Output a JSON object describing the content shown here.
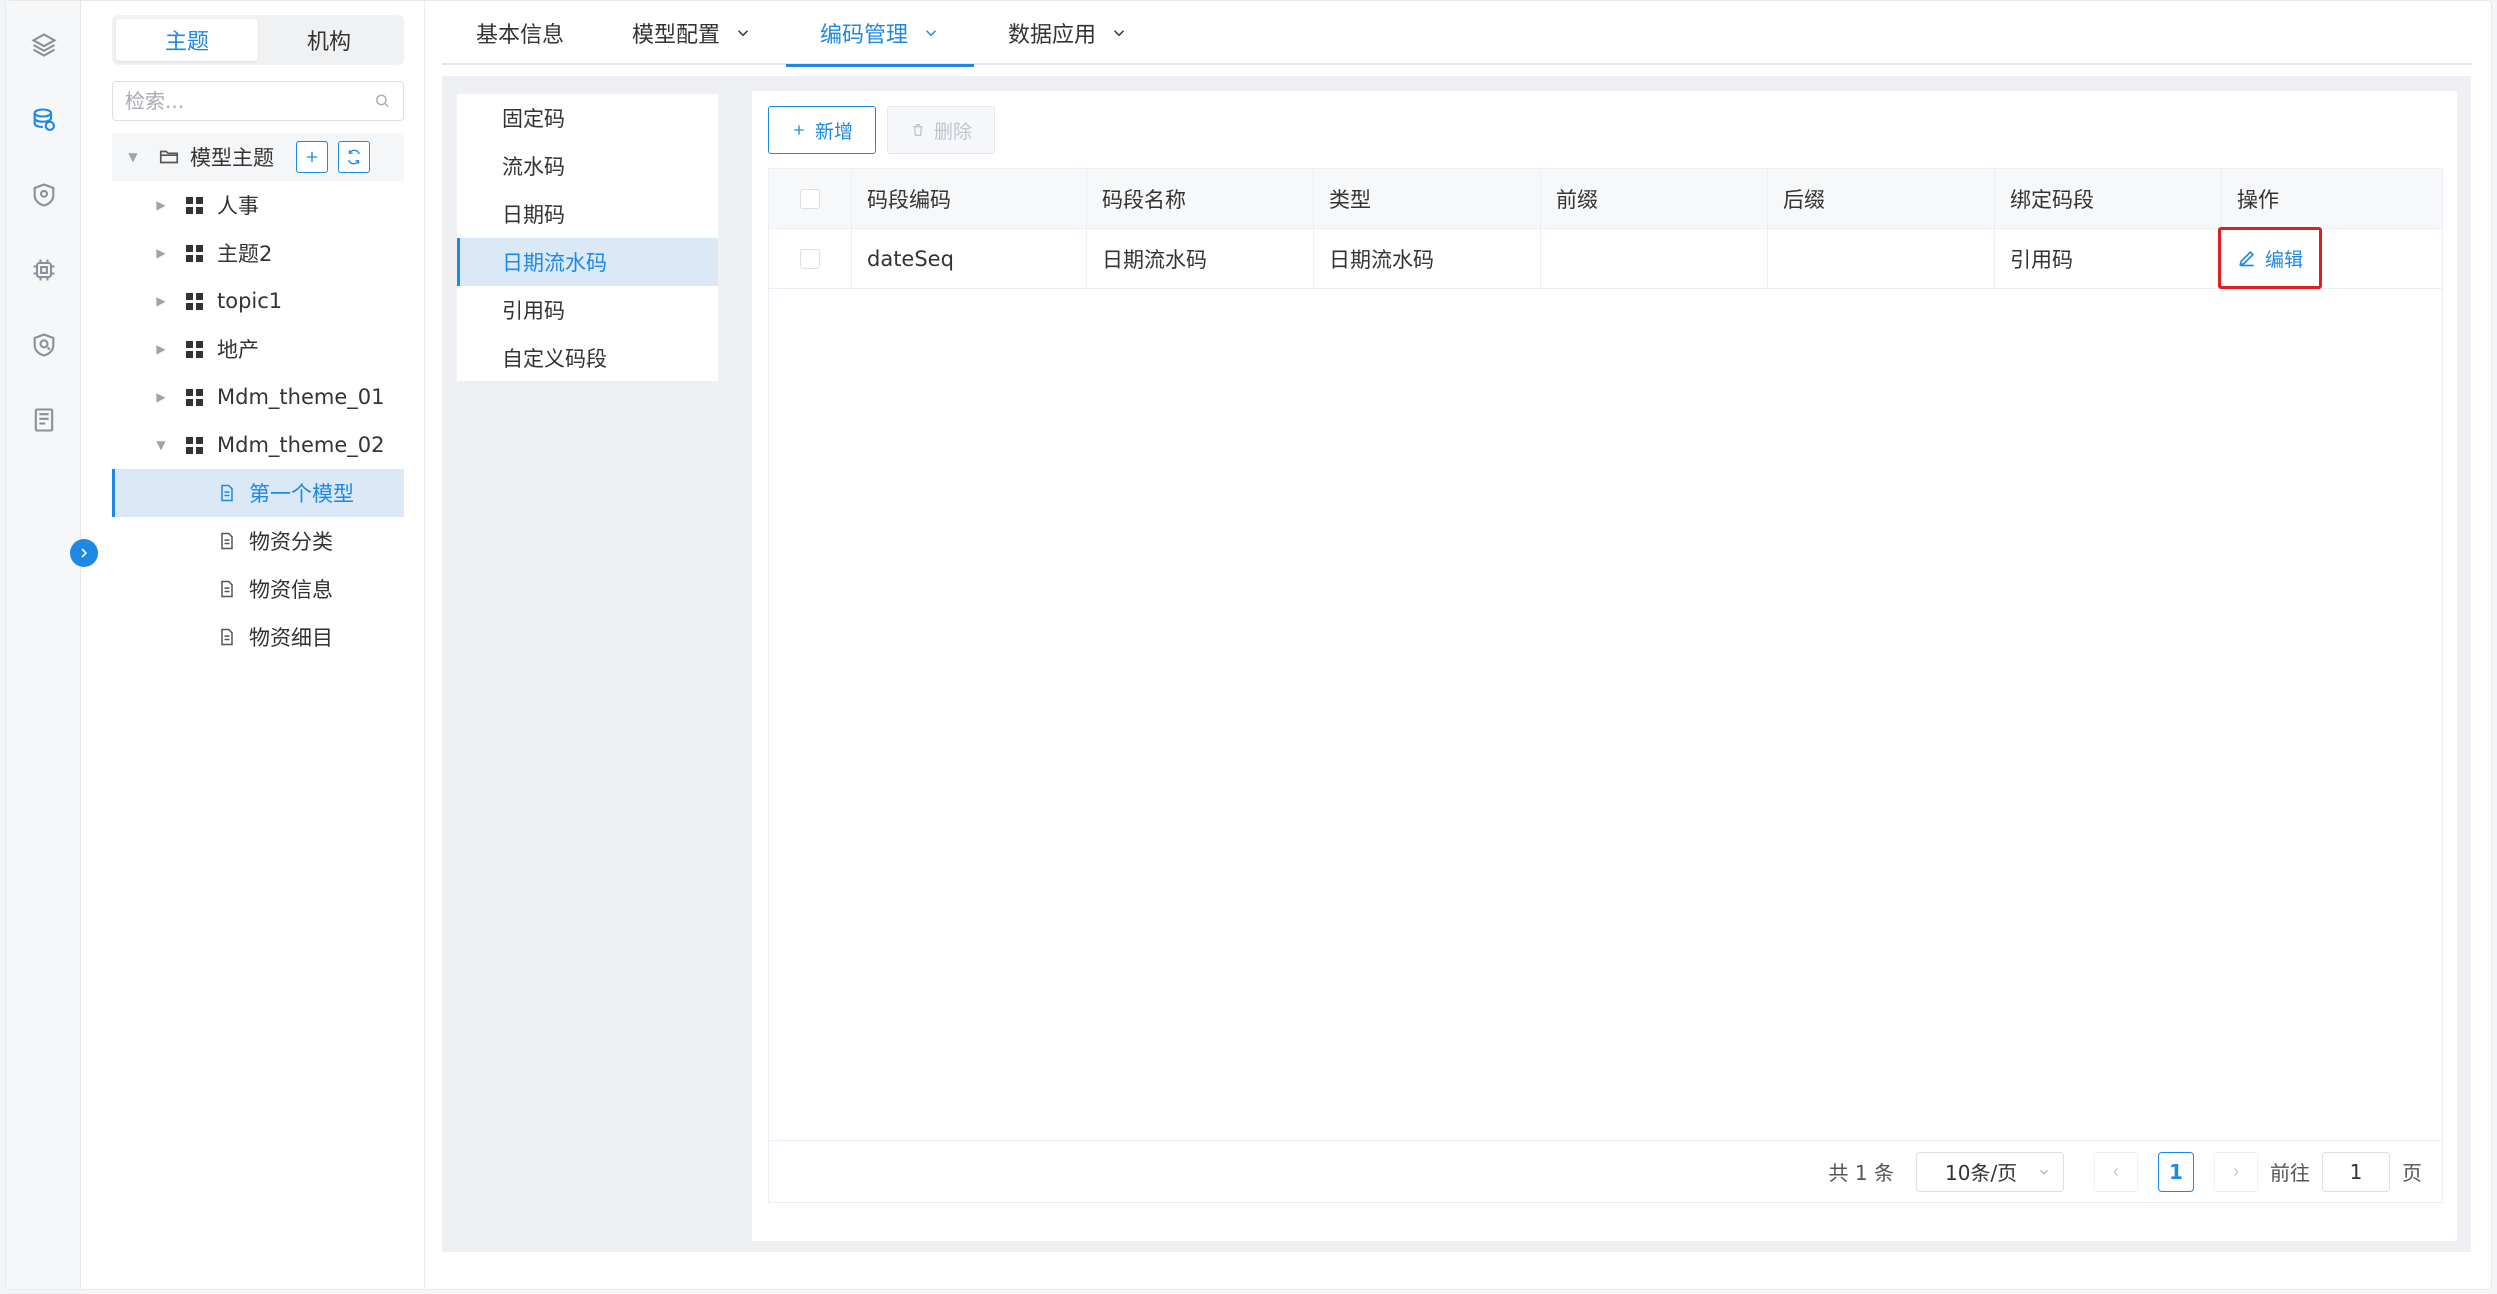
{
  "segment": {
    "theme": "主题",
    "org": "机构"
  },
  "search": {
    "placeholder": "检索..."
  },
  "tree": {
    "root": "模型主题",
    "items": [
      {
        "label": "人事"
      },
      {
        "label": "主题2"
      },
      {
        "label": "topic1"
      },
      {
        "label": "地产"
      },
      {
        "label": "Mdm_theme_01"
      },
      {
        "label": "Mdm_theme_02"
      }
    ],
    "children": [
      {
        "label": "第一个模型"
      },
      {
        "label": "物资分类"
      },
      {
        "label": "物资信息"
      },
      {
        "label": "物资细目"
      }
    ]
  },
  "tabs": [
    {
      "label": "基本信息"
    },
    {
      "label": "模型配置"
    },
    {
      "label": "编码管理"
    },
    {
      "label": "数据应用"
    }
  ],
  "subnav": [
    {
      "label": "固定码"
    },
    {
      "label": "流水码"
    },
    {
      "label": "日期码"
    },
    {
      "label": "日期流水码"
    },
    {
      "label": "引用码"
    },
    {
      "label": "自定义码段"
    }
  ],
  "toolbar": {
    "add": "新增",
    "delete": "删除"
  },
  "table": {
    "headers": [
      "码段编码",
      "码段名称",
      "类型",
      "前缀",
      "后缀",
      "绑定码段",
      "操作"
    ],
    "rows": [
      {
        "code": "dateSeq",
        "name": "日期流水码",
        "type": "日期流水码",
        "prefix": "",
        "suffix": "",
        "bind": "引用码",
        "action": "编辑"
      }
    ]
  },
  "pager": {
    "total": "共 1 条",
    "size": "10条/页",
    "page": "1",
    "goto": "前往",
    "goto_value": "1",
    "page_unit": "页"
  },
  "colors": {
    "accent": "#1e88e5",
    "highlight": "#e02020"
  }
}
